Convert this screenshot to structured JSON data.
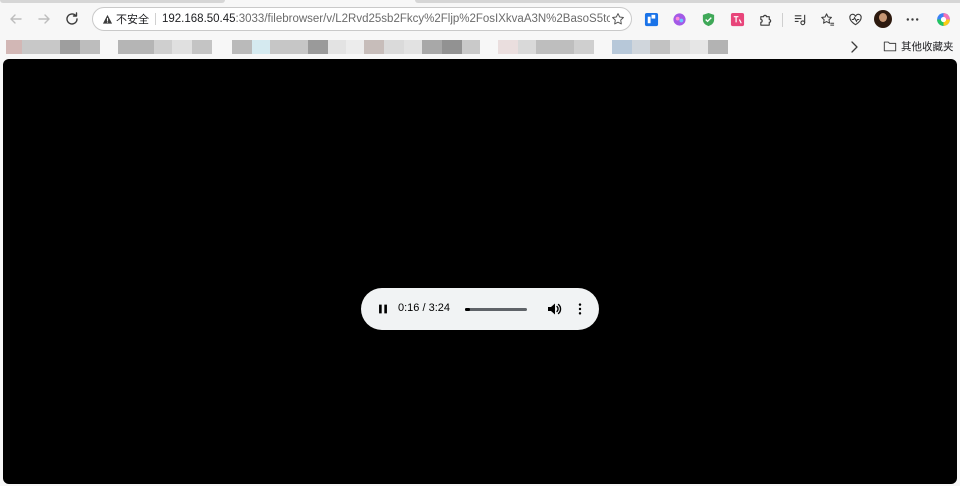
{
  "browser": {
    "security_label": "不安全",
    "url_host": "192.168.50.45",
    "url_rest": ":3033/filebrowser/v/L2Rvd25sb2Fkcy%2Fljp%2FosIXkvaA3N%2BasoS5tcDM..."
  },
  "bookmarks": {
    "other_label": "其他收藏夹"
  },
  "player": {
    "time": "0:16 / 3:24",
    "progress_fraction": 0.08
  },
  "icons": {
    "back": "arrow-left-icon",
    "forward": "arrow-right-icon",
    "reload": "reload-icon",
    "security": "warning-icon",
    "favorite": "star-icon",
    "pause": "pause-icon",
    "volume": "volume-icon",
    "menu": "more-vertical-icon"
  },
  "colors": {
    "video_bg": "#000000",
    "player_bg": "#f1f3f4"
  }
}
